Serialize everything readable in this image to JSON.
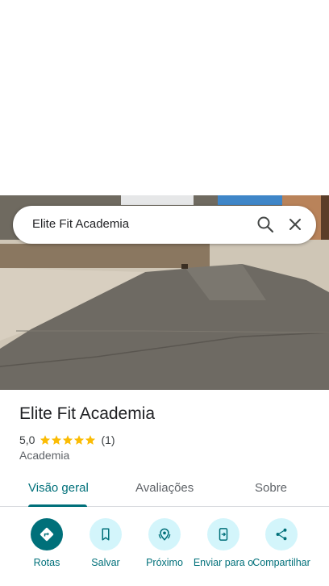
{
  "search": {
    "query": "Elite Fit Academia"
  },
  "place": {
    "name": "Elite Fit Academia",
    "rating": "5,0",
    "review_count": "(1)",
    "stars": 5,
    "category": "Academia"
  },
  "tabs": [
    {
      "label": "Visão geral",
      "active": true
    },
    {
      "label": "Avaliações",
      "active": false
    },
    {
      "label": "Sobre",
      "active": false
    }
  ],
  "actions": [
    {
      "label": "Rotas",
      "icon": "directions-icon"
    },
    {
      "label": "Salvar",
      "icon": "bookmark-icon"
    },
    {
      "label": "Próximo",
      "icon": "nearby-icon"
    },
    {
      "label": "Enviar para o",
      "icon": "send-to-phone-icon"
    },
    {
      "label": "Compartilhar",
      "icon": "share-icon"
    }
  ],
  "colors": {
    "accent": "#00707a",
    "accent_light": "#d3f5fb",
    "star": "#fbbc04",
    "text": "#202124",
    "secondary_text": "#5f6368"
  }
}
